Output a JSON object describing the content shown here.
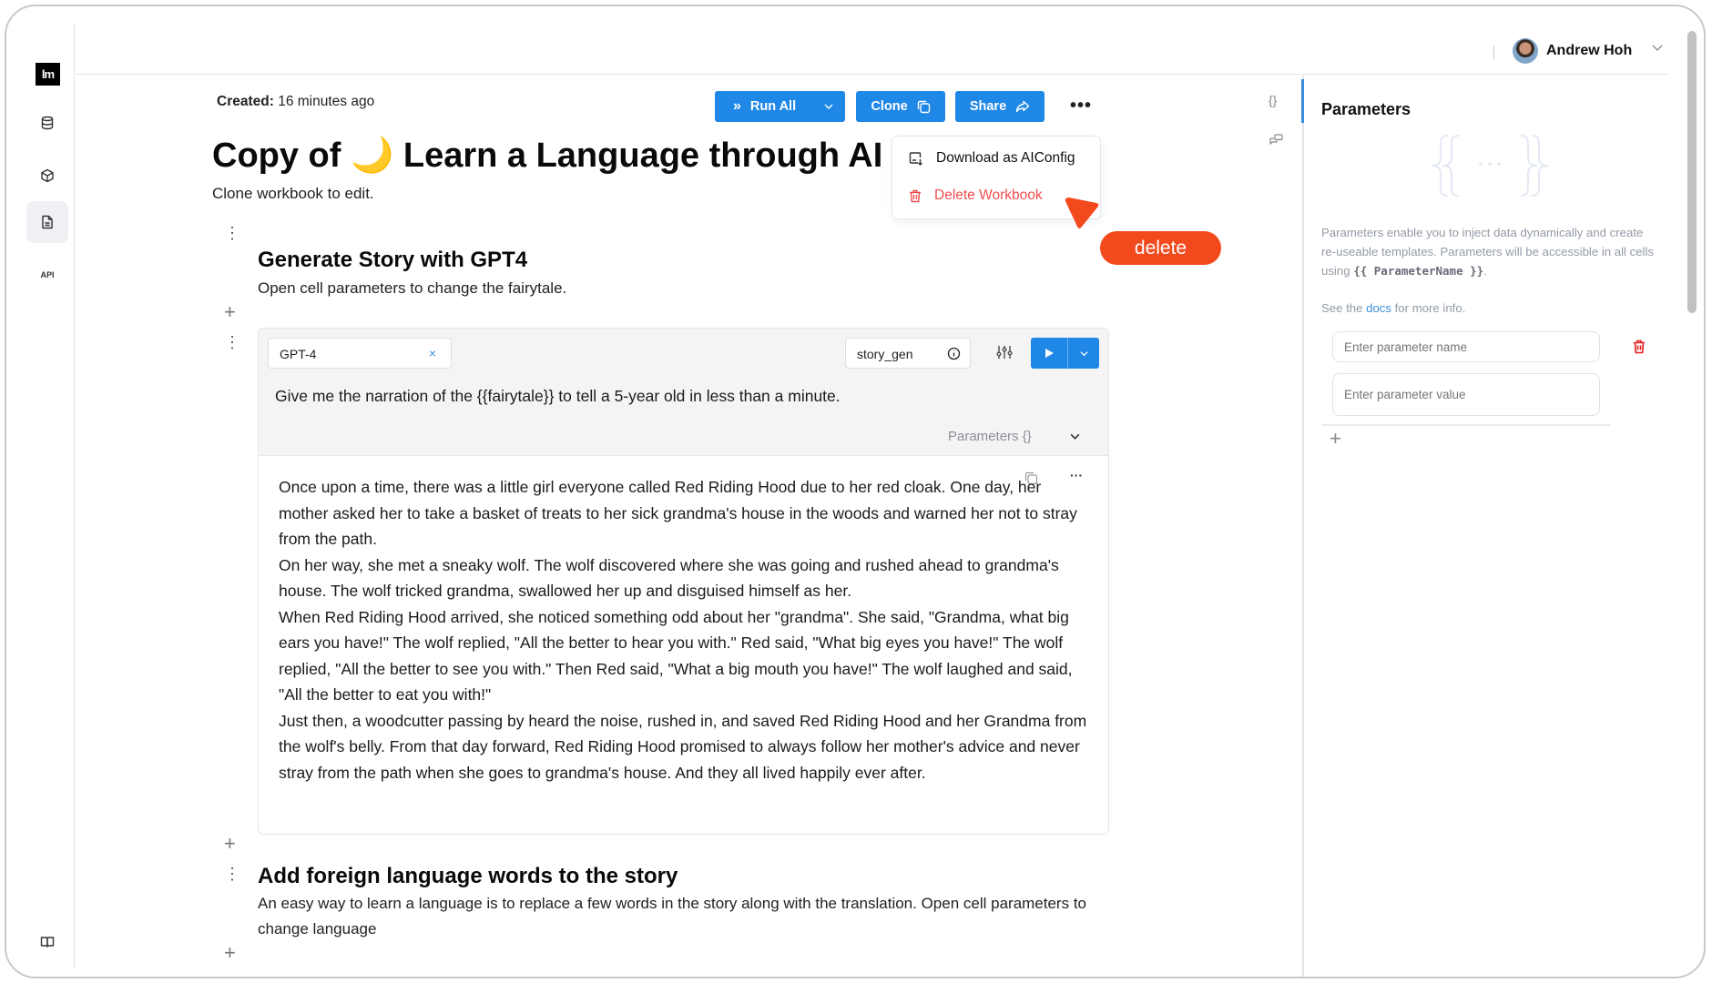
{
  "rail": {
    "logo_text": "lm",
    "items": [
      {
        "name": "database-icon"
      },
      {
        "name": "cube-icon"
      },
      {
        "name": "document-icon",
        "active": true
      },
      {
        "name": "api",
        "label": "API"
      }
    ],
    "bottom_icon": "book-icon"
  },
  "header": {
    "user_name": "Andrew Hoh"
  },
  "workbook": {
    "created_label": "Created:",
    "created_value": "16 minutes ago",
    "title": "Copy of 🌙 Learn a Language through AI",
    "subtitle": "Clone workbook to edit."
  },
  "toolbar": {
    "run_all_label": "Run All",
    "clone_label": "Clone",
    "share_label": "Share",
    "more_label": "•••",
    "accent_color": "#1f87e5"
  },
  "menu": {
    "items": [
      {
        "label": "Download as AIConfig",
        "icon": "download-config-icon"
      },
      {
        "label": "Delete Workbook",
        "icon": "trash-icon",
        "danger": true
      }
    ]
  },
  "annotation": {
    "label": "delete",
    "color": "#f34a1d"
  },
  "sections": [
    {
      "heading": "Generate Story with GPT4",
      "description": "Open cell parameters to change the fairytale."
    },
    {
      "heading": "Add foreign language words to the story",
      "description": "An easy way to learn a language is to replace a few words in the story along with the translation. Open cell parameters to change language"
    }
  ],
  "cell": {
    "model": "GPT-4",
    "name": "story_gen",
    "prompt": "Give me the narration of the {{fairytale}} to tell a 5-year old in less than a minute.",
    "parameters_toggle": "Parameters {}",
    "output": [
      "Once upon a time, there was a little girl everyone called Red Riding Hood due to her red cloak. One day, her mother asked her to take a basket of treats to her sick grandma's house in the woods and warned her not to stray from the path.",
      "On her way, she met a sneaky wolf. The wolf discovered where she was going and rushed ahead to grandma's house. The wolf tricked grandma, swallowed her up and disguised himself as her.",
      "When Red Riding Hood arrived, she noticed something odd about her \"grandma\". She said, \"Grandma, what big ears you have!\" The wolf replied, \"All the better to hear you with.\" Red said, \"What big eyes you have!\" The wolf replied, \"All the better to see you with.\" Then Red said, \"What a big mouth you have!\" The wolf laughed and said, \"All the better to eat you with!\"",
      "Just then, a woodcutter passing by heard the noise, rushed in, and saved Red Riding Hood and her Grandma from the wolf's belly. From that day forward, Red Riding Hood promised to always follow her mother's advice and never stray from the path when she goes to grandma's house. And they all lived happily ever after."
    ]
  },
  "side_icons": {
    "json": "{}"
  },
  "parameters_panel": {
    "title": "Parameters",
    "desc_before": "Parameters enable you to inject data dynamically and create re-useable templates. Parameters will be accessible in all cells using ",
    "desc_code": "{{ ParameterName }}",
    "desc_after": ".",
    "docs_before": "See the ",
    "docs_link": "docs",
    "docs_after": " for more info.",
    "name_placeholder": "Enter parameter name",
    "value_placeholder": "Enter parameter value"
  }
}
